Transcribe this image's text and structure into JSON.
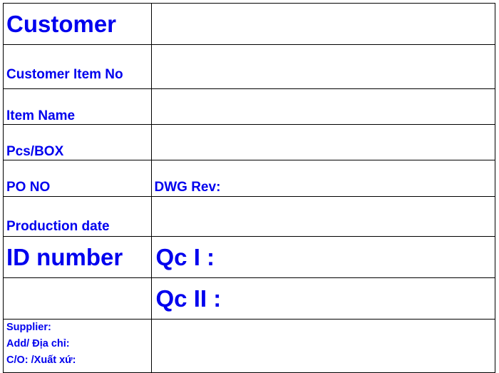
{
  "label": {
    "customer": "Customer",
    "customer_item_no": "Customer Item No",
    "item_name": "Item Name",
    "pcs_box": "Pcs/BOX",
    "po_no": "PO NO",
    "dwg_rev": "DWG Rev:",
    "production_date": "Production date",
    "id_number": "ID number",
    "qc1": "Qc I :",
    "qc2": "Qc II :",
    "supplier": "Supplier:",
    "address": "Add/ Địa chỉ:",
    "origin": "C/O: /Xuất xứ:"
  },
  "colors": {
    "text": "#0000ee",
    "border": "#000000",
    "background": "#ffffff"
  }
}
